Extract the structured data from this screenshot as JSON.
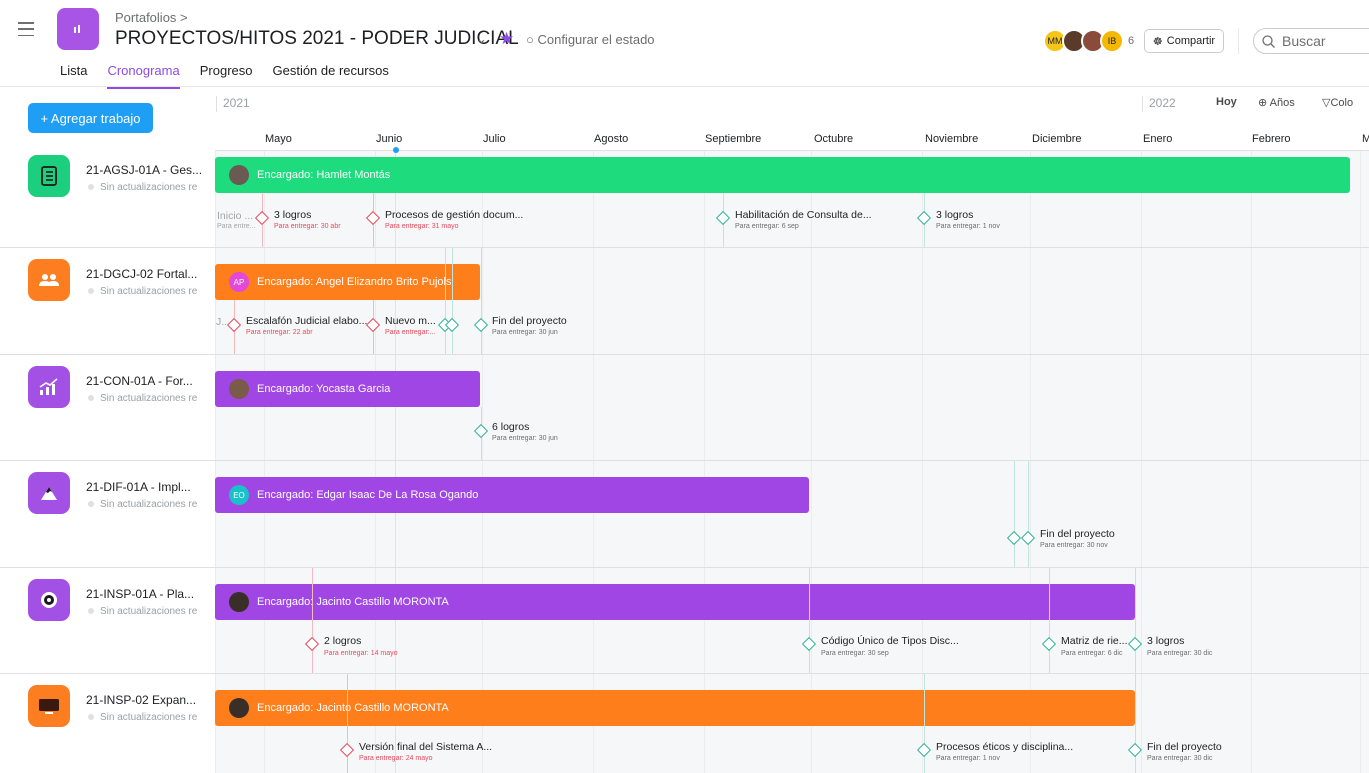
{
  "header": {
    "breadcrumb": "Portafolios >",
    "title": "PROYECTOS/HITOS 2021 - PODER JUDICIAL",
    "status": "Configurar el estado",
    "avatars": [
      "MM",
      "",
      "",
      "IB"
    ],
    "avatar_count": "6",
    "share_label": "Compartir",
    "search_placeholder": "Buscar"
  },
  "tabs": [
    "Lista",
    "Cronograma",
    "Progreso",
    "Gestión de recursos"
  ],
  "toolbar": {
    "add_work": "+ Agregar trabajo",
    "year_start": "2021",
    "year_next": "2022",
    "today": "Hoy",
    "years": "Años",
    "colors": "Colo"
  },
  "months": [
    "Mayo",
    "Junio",
    "Julio",
    "Agosto",
    "Septiembre",
    "Octubre",
    "Noviembre",
    "Diciembre",
    "Enero",
    "Febrero",
    "M"
  ],
  "rows": [
    {
      "name": "21-AGSJ-01A - Ges...",
      "update": "Sin actualizaciones re",
      "icon_color": "#1ccf7f",
      "icon": "list-icon",
      "bar": {
        "label": "Encargado: Hamlet Montás",
        "color": "#1edb7e",
        "avatar": ""
      },
      "milestones": [
        {
          "name": "Inicio ...",
          "due": "Para entre..."
        },
        {
          "name": "3 logros",
          "due": "Para entregar: 30 abr"
        },
        {
          "name": "Procesos de gestión docum...",
          "due": "Para entregar: 31 mayo"
        },
        {
          "name": "Habilitación de Consulta de...",
          "due": "Para entregar: 6 sep"
        },
        {
          "name": "3 logros",
          "due": "Para entregar: 1 nov"
        }
      ]
    },
    {
      "name": "21-DGCJ-02 Fortal...",
      "update": "Sin actualizaciones re",
      "icon_color": "#fd7e21",
      "icon": "people-icon",
      "bar": {
        "label": "Encargado: Angel Elizandro Brito Pujols",
        "color": "#fd7e1b",
        "avatar": "AP"
      },
      "milestones": [
        {
          "name": "J...",
          "due": ""
        },
        {
          "name": "Escalafón Judicial elabo...",
          "due": "Para entregar: 22 abr"
        },
        {
          "name": "Nuevo m...",
          "due": "Para entregar:..."
        },
        {
          "name": "Fin del proyecto",
          "due": "Para entregar: 30 jun"
        }
      ]
    },
    {
      "name": "21-CON-01A - For...",
      "update": "Sin actualizaciones re",
      "icon_color": "#a351e4",
      "icon": "trend-chart-icon",
      "bar": {
        "label": "Encargado: Yocasta Garcia",
        "color": "#a046e5",
        "avatar": ""
      },
      "milestones": [
        {
          "name": "6 logros",
          "due": "Para entregar: 30 jun"
        }
      ]
    },
    {
      "name": "21-DIF-01A - Impl...",
      "update": "Sin actualizaciones re",
      "icon_color": "#a351e4",
      "icon": "mountain-icon",
      "bar": {
        "label": "Encargado: Edgar Isaac De La Rosa Ogando",
        "color": "#a046e5",
        "avatar": "EO"
      },
      "milestones": [
        {
          "name": "Fin del proyecto",
          "due": "Para entregar: 30 nov"
        }
      ]
    },
    {
      "name": "21-INSP-01A - Pla...",
      "update": "Sin actualizaciones re",
      "icon_color": "#a351e4",
      "icon": "target-icon",
      "bar": {
        "label": "Encargado: Jacinto Castillo MORONTA",
        "color": "#a046e5",
        "avatar": ""
      },
      "milestones": [
        {
          "name": "2 logros",
          "due": "Para entregar: 14 mayo"
        },
        {
          "name": "Código Único de Tipos Disc...",
          "due": "Para entregar: 30 sep"
        },
        {
          "name": "Matriz de rie...",
          "due": "Para entregar: 6 dic"
        },
        {
          "name": "3 logros",
          "due": "Para entregar: 30 dic"
        }
      ]
    },
    {
      "name": "21-INSP-02 Expan...",
      "update": "Sin actualizaciones re",
      "icon_color": "#fd7e21",
      "icon": "monitor-icon",
      "bar": {
        "label": "Encargado: Jacinto Castillo MORONTA",
        "color": "#fd7e1b",
        "avatar": ""
      },
      "milestones": [
        {
          "name": "Versión final del Sistema A...",
          "due": "Para entregar: 24 mayo"
        },
        {
          "name": "Procesos éticos y disciplina...",
          "due": "Para entregar: 1 nov"
        },
        {
          "name": "Fin del proyecto",
          "due": "Para entregar: 30 dic"
        }
      ]
    }
  ]
}
